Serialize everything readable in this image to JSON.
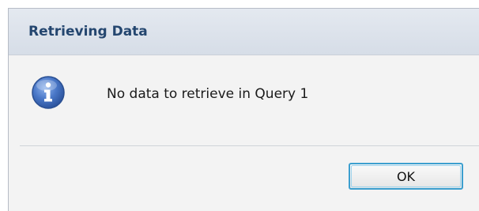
{
  "dialog": {
    "title": "Retrieving Data",
    "icon": "info-icon",
    "message": "No data to retrieve in Query 1",
    "ok_label": "OK"
  },
  "colors": {
    "title_text": "#24466f",
    "title_bar": "#dde3eb",
    "dialog_bg": "#f3f3f3",
    "icon_blue": "#3f6fc2",
    "button_focus": "#3c9fcf"
  }
}
